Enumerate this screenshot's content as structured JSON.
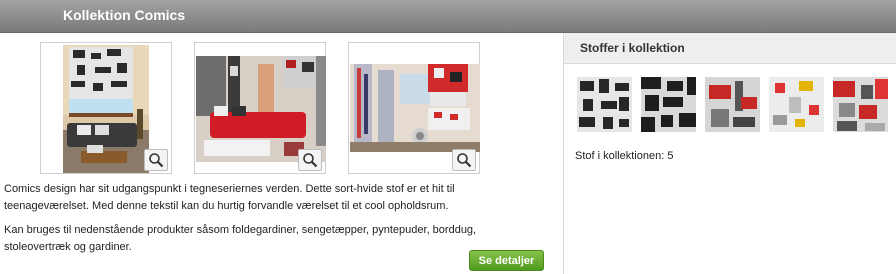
{
  "header": {
    "title": "Kollektion Comics"
  },
  "gallery": {
    "images": [
      {
        "name": "roman-blind-photo",
        "zoom_icon": "magnifier-icon"
      },
      {
        "name": "red-sofa-room-photo",
        "zoom_icon": "magnifier-icon"
      },
      {
        "name": "curtains-room-photo",
        "zoom_icon": "magnifier-icon"
      }
    ]
  },
  "description": {
    "paragraph1": "Comics design har sit udgangspunkt i tegneseriernes verden. Dette sort-hvide stof er et hit til teenageværelset. Med denne tekstil kan du hurtig forvandle værelset til et cool opholdsrum.",
    "paragraph2": "Kan bruges til nedenstående produkter såsom foldegardiner, sengetæpper, pyntepuder, borddug, stoleovertræk og gardiner."
  },
  "details_button": {
    "label": "Se detaljer",
    "color": "#5fa629"
  },
  "sidebar": {
    "title": "Stoffer i kollektion",
    "swatches": [
      "comics-bw-1",
      "comics-bw-2",
      "comics-red-bus",
      "comics-london-color",
      "comics-red-pattern"
    ],
    "count_text": "Stof i kollektionen: 5"
  },
  "colors": {
    "header": "#8c8c8c",
    "accent_green": "#5fa629"
  }
}
